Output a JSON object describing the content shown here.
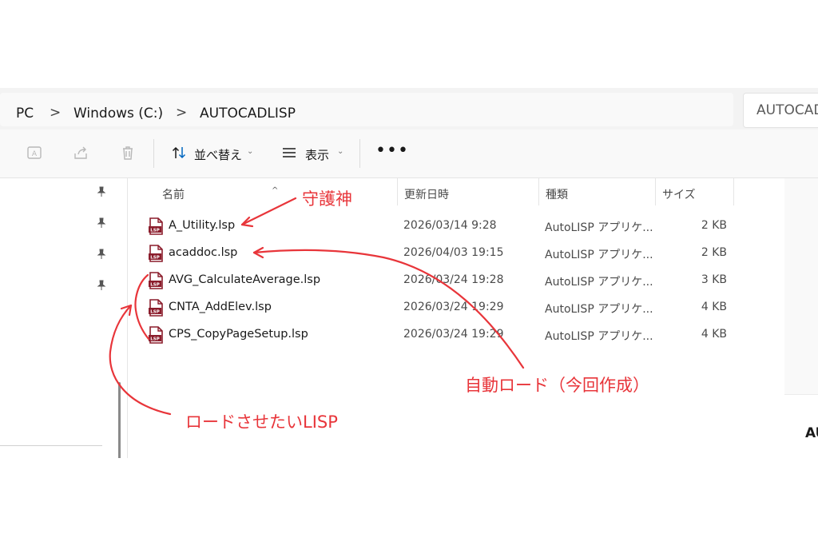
{
  "address": {
    "crumbs": [
      "PC",
      "Windows (C:)",
      "AUTOCADLISP"
    ],
    "separator": ">",
    "search_text": "AUTOCAD"
  },
  "toolbar": {
    "sort_label": "並べ替え",
    "view_label": "表示",
    "more_label": "•••",
    "chevron": "⌄"
  },
  "columns": {
    "name": "名前",
    "date": "更新日時",
    "type": "種類",
    "size": "サイズ",
    "sort_indicator": "^"
  },
  "files": [
    {
      "name": "A_Utility.lsp",
      "date": "2026/03/14 9:28",
      "type": "AutoLISP アプリケ...",
      "size": "2 KB"
    },
    {
      "name": "acaddoc.lsp",
      "date": "2026/04/03 19:15",
      "type": "AutoLISP アプリケ...",
      "size": "2 KB"
    },
    {
      "name": "AVG_CalculateAverage.lsp",
      "date": "2026/03/24 19:28",
      "type": "AutoLISP アプリケ...",
      "size": "3 KB"
    },
    {
      "name": "CNTA_AddElev.lsp",
      "date": "2026/03/24 19:29",
      "type": "AutoLISP アプリケ...",
      "size": "4 KB"
    },
    {
      "name": "CPS_CopyPageSetup.lsp",
      "date": "2026/03/24 19:29",
      "type": "AutoLISP アプリケ...",
      "size": "4 KB"
    }
  ],
  "file_icon_text": "LSP",
  "details_pane_text": "AU",
  "annotations": {
    "guardian": "守護神",
    "autoload": "自動ロード（今回作成）",
    "to_load": "ロードさせたいLISP",
    "color": "#e8353a"
  },
  "colors": {
    "file_icon": "#8b1d2c",
    "accent": "#0067c0"
  }
}
